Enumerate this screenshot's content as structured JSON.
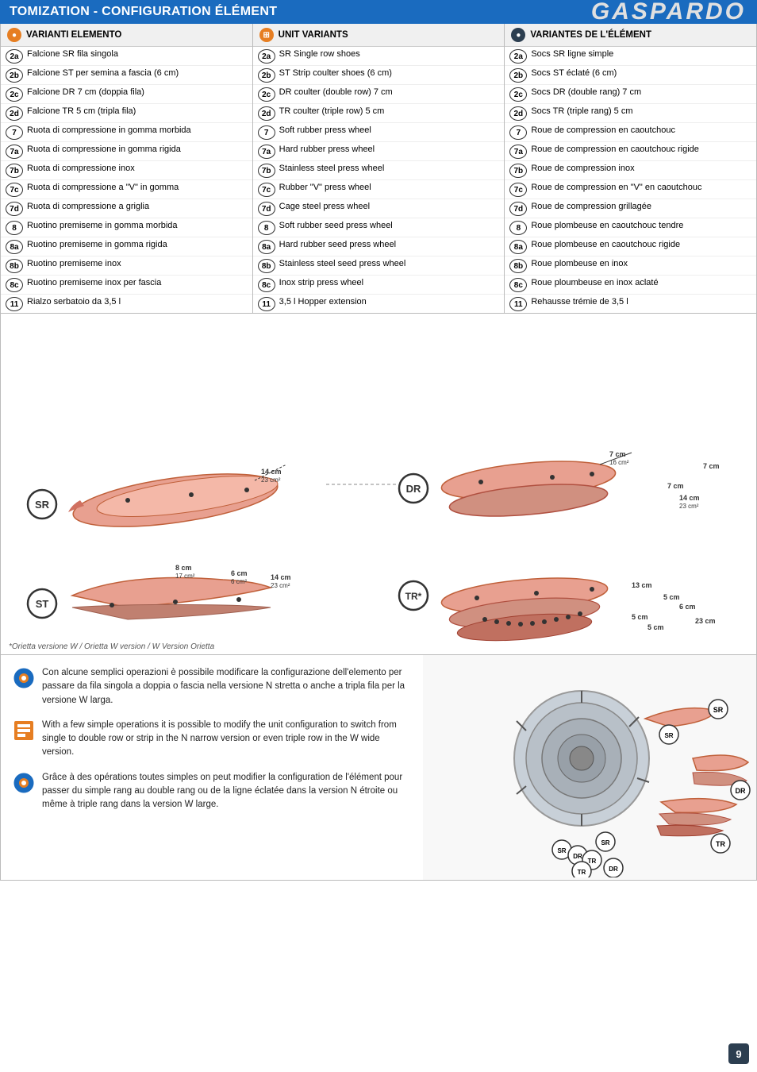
{
  "logo": "GASPARDO",
  "header": {
    "title": "TOMIZATION - CONFIGURATION ÉLÉMENT"
  },
  "columns": [
    {
      "id": "col1",
      "header": "VARIANTI ELEMENTO",
      "icon": "orange",
      "rows": [
        {
          "badge": "2a",
          "text": "Falcione SR fila singola"
        },
        {
          "badge": "2b",
          "text": "Falcione ST per semina a fascia (6 cm)"
        },
        {
          "badge": "2c",
          "text": "Falcione DR 7 cm (doppia fila)"
        },
        {
          "badge": "2d",
          "text": "Falcione TR 5 cm (tripla fila)"
        },
        {
          "badge": "7",
          "text": "Ruota di compressione in gomma morbida"
        },
        {
          "badge": "7a",
          "text": "Ruota di compressione in gomma rigida"
        },
        {
          "badge": "7b",
          "text": "Ruota di compressione inox"
        },
        {
          "badge": "7c",
          "text": "Ruota di compressione a \"V\" in gomma"
        },
        {
          "badge": "7d",
          "text": "Ruota di compressione a griglia"
        },
        {
          "badge": "8",
          "text": "Ruotino premiseme in gomma morbida"
        },
        {
          "badge": "8a",
          "text": "Ruotino premiseme in gomma rigida"
        },
        {
          "badge": "8b",
          "text": "Ruotino premiseme inox"
        },
        {
          "badge": "8c",
          "text": "Ruotino premiseme inox per fascia"
        },
        {
          "badge": "11",
          "text": "Rialzo serbatoio da 3,5 l"
        }
      ]
    },
    {
      "id": "col2",
      "header": "UNIT VARIANTS",
      "icon": "blue",
      "rows": [
        {
          "badge": "2a",
          "text": "SR Single row shoes"
        },
        {
          "badge": "2b",
          "text": "ST Strip coulter shoes (6 cm)"
        },
        {
          "badge": "2c",
          "text": "DR coulter (double row) 7 cm"
        },
        {
          "badge": "2d",
          "text": "TR coulter (triple row) 5 cm"
        },
        {
          "badge": "7",
          "text": "Soft rubber press wheel"
        },
        {
          "badge": "7a",
          "text": "Hard rubber press wheel"
        },
        {
          "badge": "7b",
          "text": "Stainless steel press wheel"
        },
        {
          "badge": "7c",
          "text": "Rubber \"V\" press wheel"
        },
        {
          "badge": "7d",
          "text": "Cage steel press wheel"
        },
        {
          "badge": "8",
          "text": "Soft rubber seed press wheel"
        },
        {
          "badge": "8a",
          "text": "Hard rubber seed press wheel"
        },
        {
          "badge": "8b",
          "text": "Stainless steel seed press wheel"
        },
        {
          "badge": "8c",
          "text": "Inox strip press wheel"
        },
        {
          "badge": "11",
          "text": "3,5 l Hopper extension"
        }
      ]
    },
    {
      "id": "col3",
      "header": "VARIANTES DE L'ÉLÉMENT",
      "icon": "navy",
      "rows": [
        {
          "badge": "2a",
          "text": "Socs SR ligne simple"
        },
        {
          "badge": "2b",
          "text": "Socs ST éclaté (6 cm)"
        },
        {
          "badge": "2c",
          "text": "Socs DR (double rang) 7 cm"
        },
        {
          "badge": "2d",
          "text": "Socs TR (triple rang) 5 cm"
        },
        {
          "badge": "7",
          "text": "Roue de compression en caoutchouc"
        },
        {
          "badge": "7a",
          "text": "Roue de compression en caoutchouc rigide"
        },
        {
          "badge": "7b",
          "text": "Roue de compression inox"
        },
        {
          "badge": "7c",
          "text": "Roue de compression en \"V\" en caoutchouc"
        },
        {
          "badge": "7d",
          "text": "Roue de compression grillagée"
        },
        {
          "badge": "8",
          "text": "Roue plombeuse en caoutchouc tendre"
        },
        {
          "badge": "8a",
          "text": "Roue plombeuse en caoutchouc rigide"
        },
        {
          "badge": "8b",
          "text": "Roue plombeuse en inox"
        },
        {
          "badge": "8c",
          "text": "Roue ploumbeuse en inox aclaté"
        },
        {
          "badge": "11",
          "text": "Rehausse trémie de 3,5 l"
        }
      ]
    }
  ],
  "diagram": {
    "labels": [
      "SR",
      "ST",
      "DR",
      "TR"
    ],
    "footnote": "*Orietta versione W / Orietta W version / W Version Orietta",
    "measurements": {
      "sr": [
        "14 cm",
        "23 cm²"
      ],
      "st": [
        "8 cm",
        "17 cm²",
        "6 cm",
        "6 cm²",
        "14 cm",
        "23 cm²"
      ],
      "dr": [
        "7 cm",
        "16 cm²",
        "7 cm",
        "7 cm",
        "14 cm",
        "23 cm²"
      ],
      "tr": [
        "13 cm",
        "5 cm",
        "6 cm",
        "5 cm",
        "5 cm",
        "23 cm"
      ]
    }
  },
  "footer": {
    "text_blocks": [
      {
        "lang": "it",
        "content": "Con alcune semplici operazioni è possibile modificare la configurazione dell'elemento per passare da fila singola a doppia o fascia nella versione N stretta o anche a tripla fila per la versione W larga."
      },
      {
        "lang": "en",
        "content": "With a few simple operations it is possible to modify the unit configuration to switch from single to double row or strip in the N narrow version or even triple row in the W wide version."
      },
      {
        "lang": "fr",
        "content": "Grâce à des opérations toutes simples on peut modifier la configuration de l'élément pour passer du simple rang au double rang ou de la ligne éclatée dans la version N étroite ou même à triple rang dans la version W large."
      }
    ],
    "image_labels": [
      "SR",
      "DR",
      "TR",
      "SR",
      "DR",
      "TR",
      "SR",
      "DR",
      "TR"
    ]
  },
  "page_number": "9"
}
